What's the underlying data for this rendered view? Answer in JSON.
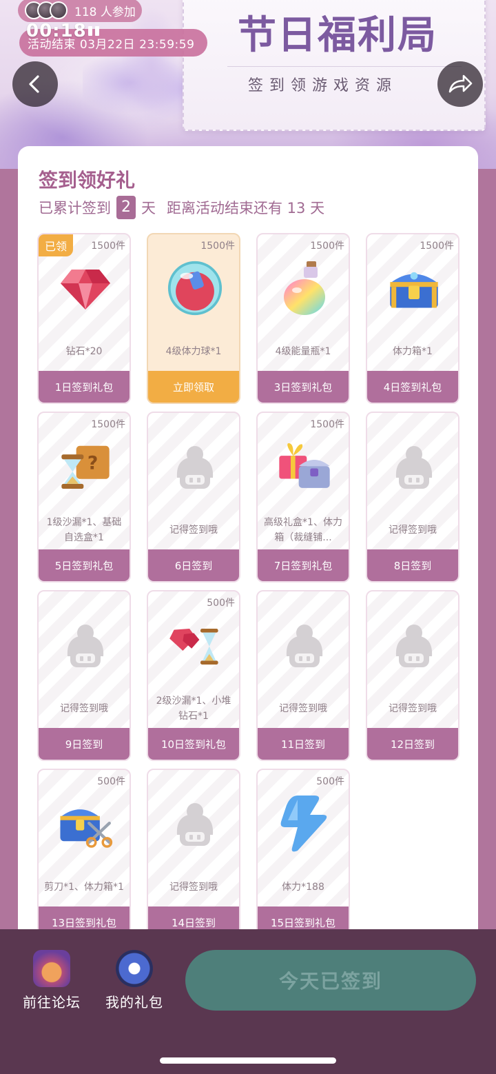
{
  "header": {
    "participants": "118 人参加",
    "status_time": "00:18",
    "end_time": "活动结束 03月22日 23:59:59",
    "banner_title": "节日福利局",
    "banner_subtitle": "签到领游戏资源",
    "back_icon": "chevron-left-icon",
    "share_icon": "share-arrow-icon"
  },
  "checkin": {
    "title": "签到领好礼",
    "progress_prefix": "已累计签到",
    "days_signed": "2",
    "progress_unit": "天",
    "remaining_text": "距离活动结束还有 13 天"
  },
  "tiles": [
    {
      "qty": "1500件",
      "name": "钻石*20",
      "foot": "1日签到礼包",
      "badge": "已领",
      "icon": "ruby-gem-icon",
      "state": "claimed"
    },
    {
      "qty": "1500件",
      "name": "4级体力球*1",
      "foot": "立即领取",
      "badge": "",
      "icon": "stamina-orb-icon",
      "state": "available"
    },
    {
      "qty": "1500件",
      "name": "4级能量瓶*1",
      "foot": "3日签到礼包",
      "badge": "",
      "icon": "energy-potion-icon",
      "state": "locked"
    },
    {
      "qty": "1500件",
      "name": "体力箱*1",
      "foot": "4日签到礼包",
      "badge": "",
      "icon": "treasure-chest-icon",
      "state": "locked"
    },
    {
      "qty": "1500件",
      "name": "1级沙漏*1、基础自选盒*1",
      "foot": "5日签到礼包",
      "badge": "",
      "icon": "hourglass-mystery-box-icon",
      "state": "locked"
    },
    {
      "qty": "",
      "name": "记得签到哦",
      "foot": "6日签到",
      "badge": "",
      "icon": "placeholder-character-icon",
      "state": "empty"
    },
    {
      "qty": "1500件",
      "name": "高级礼盒*1、体力箱（裁缝铺...",
      "foot": "7日签到礼包",
      "badge": "",
      "icon": "gift-box-chest-icon",
      "state": "locked"
    },
    {
      "qty": "",
      "name": "记得签到哦",
      "foot": "8日签到",
      "badge": "",
      "icon": "placeholder-character-icon",
      "state": "empty"
    },
    {
      "qty": "",
      "name": "记得签到哦",
      "foot": "9日签到",
      "badge": "",
      "icon": "placeholder-character-icon",
      "state": "empty"
    },
    {
      "qty": "500件",
      "name": "2级沙漏*1、小堆钻石*1",
      "foot": "10日签到礼包",
      "badge": "",
      "icon": "gems-hourglass-icon",
      "state": "locked"
    },
    {
      "qty": "",
      "name": "记得签到哦",
      "foot": "11日签到",
      "badge": "",
      "icon": "placeholder-character-icon",
      "state": "empty"
    },
    {
      "qty": "",
      "name": "记得签到哦",
      "foot": "12日签到",
      "badge": "",
      "icon": "placeholder-character-icon",
      "state": "empty"
    },
    {
      "qty": "500件",
      "name": "剪刀*1、体力箱*1",
      "foot": "13日签到礼包",
      "badge": "",
      "icon": "scissors-chest-icon",
      "state": "locked"
    },
    {
      "qty": "",
      "name": "记得签到哦",
      "foot": "14日签到",
      "badge": "",
      "icon": "placeholder-character-icon",
      "state": "empty"
    },
    {
      "qty": "500件",
      "name": "体力*188",
      "foot": "15日签到礼包",
      "badge": "",
      "icon": "lightning-stamina-icon",
      "state": "locked"
    }
  ],
  "bottom": {
    "forum_label": "前往论坛",
    "mygift_label": "我的礼包",
    "signed_label": "今天已签到"
  },
  "colors": {
    "accent": "#b06f9c",
    "highlight": "#f2ad44",
    "button_disabled": "#4e7f7a",
    "bottom_bar": "#5a3750"
  }
}
